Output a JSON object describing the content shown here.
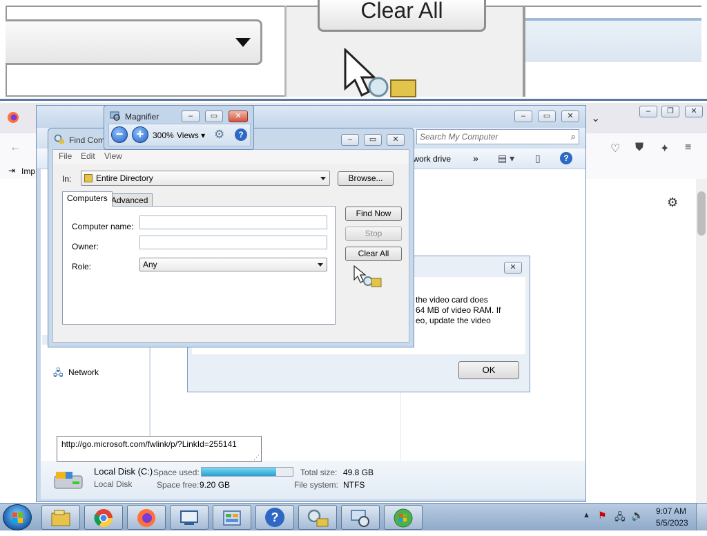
{
  "lens": {
    "button_label": "Clear All"
  },
  "browser": {
    "bookmark_import": "Imp",
    "icons": [
      "back-arrow-icon",
      "pocket-icon",
      "ublock-icon",
      "extensions-icon",
      "menu-icon",
      "gear-icon"
    ]
  },
  "explorer": {
    "search_placeholder": "Search My Computer",
    "cmd_network_drive": "twork drive",
    "cmd_more": "»",
    "nav_network": "Network",
    "details": {
      "disk_name": "Local Disk (C:)",
      "disk_type": "Local Disk",
      "space_used_label": "Space used:",
      "space_used_fraction": 0.82,
      "space_free_label": "Space free:",
      "space_free_value": "9.20 GB",
      "total_size_label": "Total size:",
      "total_size_value": "49.8 GB",
      "file_system_label": "File system:",
      "file_system_value": "NTFS"
    }
  },
  "warning_dialog": {
    "line1": "the video card does",
    "line2": "64 MB of video RAM. If",
    "line3": "eo, update the video",
    "ok_label": "OK"
  },
  "find_dialog": {
    "title": "Find Com",
    "menu": [
      "File",
      "Edit",
      "View"
    ],
    "in_label": "In:",
    "in_value": "Entire Directory",
    "browse_label": "Browse...",
    "tabs": [
      "Computers",
      "Advanced"
    ],
    "computer_name_label": "Computer name:",
    "owner_label": "Owner:",
    "role_label": "Role:",
    "role_value": "Any",
    "find_now_label": "Find Now",
    "stop_label": "Stop",
    "clear_all_label": "Clear All"
  },
  "magnifier": {
    "title": "Magnifier",
    "zoom": "300%",
    "views_label": "Views"
  },
  "tooltip": {
    "text": "http://go.microsoft.com/fwlink/p/?LinkId=255141"
  },
  "taskbar": {
    "time": "9:07 AM",
    "date": "5/5/2023",
    "apps": [
      "explorer-icon",
      "chrome-icon",
      "firefox-icon",
      "remote-icon",
      "control-panel-icon",
      "help-icon",
      "find-icon",
      "network-icon",
      "windows-update-icon"
    ]
  }
}
